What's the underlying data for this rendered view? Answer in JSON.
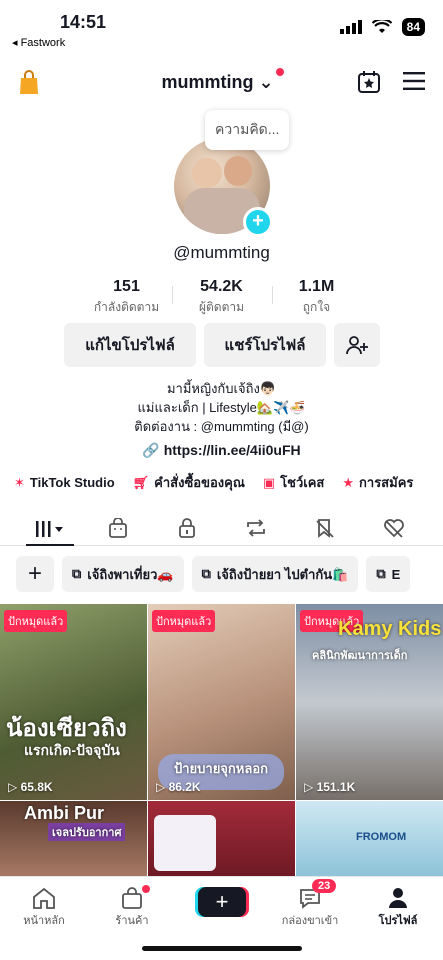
{
  "status_bar": {
    "time": "14:51",
    "back_app": "◂ Fastwork",
    "battery": "84"
  },
  "header": {
    "username": "mummting"
  },
  "bubble": {
    "text": "ความคิด..."
  },
  "profile": {
    "handle": "@mummting",
    "stats": [
      {
        "value": "151",
        "label": "กำลังติดตาม"
      },
      {
        "value": "54.2K",
        "label": "ผู้ติดตาม"
      },
      {
        "value": "1.1M",
        "label": "ถูกใจ"
      }
    ],
    "buttons": {
      "edit": "แก้ไขโปรไฟล์",
      "share": "แชร์โปรไฟล์"
    },
    "bio": [
      "มามี้หญิงกับเจ้ถิง👦🏻",
      "แม่และเด็ก | Lifestyle🏡✈️🍜",
      "ติดต่องาน : @mummting (มี@)"
    ],
    "link": "https://lin.ee/4ii0uFH"
  },
  "quick_links": [
    {
      "label": "TikTok Studio",
      "icon": "studio-icon"
    },
    {
      "label": "คำสั่งซื้อของคุณ",
      "icon": "cart-icon"
    },
    {
      "label": "โชว์เคส",
      "icon": "bag-icon"
    },
    {
      "label": "การสมัคร",
      "icon": "star-icon"
    }
  ],
  "playlists": [
    {
      "label": "เจ้ถิงพาเที่ยว🚗"
    },
    {
      "label": "เจ้ถิงป้ายยา ไปตำกัน🛍️"
    },
    {
      "label": "E"
    }
  ],
  "videos": [
    {
      "pinned": "ปักหมุดแล้ว",
      "views": "65.8K",
      "overlay_title": "น้องเซียวถิง",
      "overlay_sub": "แรกเกิด-ปัจจุบัน",
      "bg": "#6e7f4a"
    },
    {
      "pinned": "ปักหมุดแล้ว",
      "views": "86.2K",
      "overlay_title": "ป้ายบายจุกหลอก",
      "overlay_sub": "",
      "bg": "#c9a98f"
    },
    {
      "pinned": "ปักหมุดแล้ว",
      "views": "151.1K",
      "overlay_title": "Kamy Kids",
      "overlay_sub": "คลินิกพัฒนาการเด็ก",
      "bg": "#8f9aa8"
    },
    {
      "overlay_title": "Ambi Pur",
      "overlay_sub": "เจลปรับอากาศ",
      "bg": "#7a4d3b"
    },
    {
      "overlay_title": "",
      "overlay_sub": "",
      "bg": "#9a2030"
    },
    {
      "overlay_title": "FROMOM",
      "overlay_sub": "",
      "bg": "#a8d4e6"
    }
  ],
  "bottom_nav": [
    {
      "label": "หน้าหลัก",
      "icon": "home-icon"
    },
    {
      "label": "ร้านค้า",
      "icon": "shop-icon"
    },
    {
      "label": "",
      "icon": "create-icon"
    },
    {
      "label": "กล่องขาเข้า",
      "icon": "inbox-icon",
      "badge": "23"
    },
    {
      "label": "โปรไฟล์",
      "icon": "profile-icon"
    }
  ],
  "colors": {
    "accent": "#fe2c55",
    "cyan": "#20d5ec",
    "text": "#161823"
  }
}
